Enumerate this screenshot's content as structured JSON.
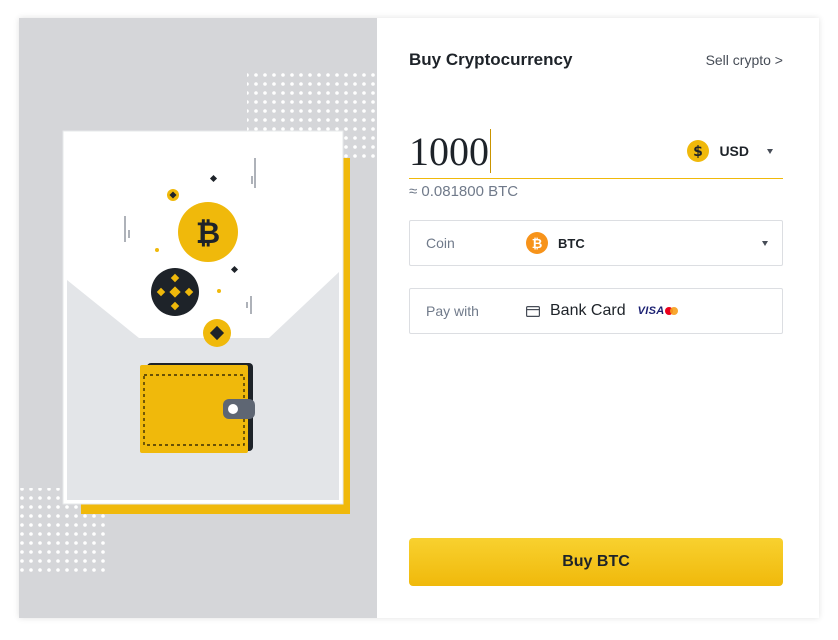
{
  "header": {
    "title": "Buy Cryptocurrency",
    "sell_link": "Sell crypto >"
  },
  "amount": {
    "value": "1000",
    "currency": "USD",
    "currency_icon": "dollar-coin-icon",
    "approx": "≈ 0.081800 BTC"
  },
  "coin_field": {
    "label": "Coin",
    "value": "BTC",
    "icon": "bitcoin-icon"
  },
  "pay_field": {
    "label": "Pay with",
    "value": "Bank Card",
    "brand": "VISA",
    "icon": "card-icon"
  },
  "buy_button": {
    "label": "Buy BTC"
  },
  "colors": {
    "accent": "#f0b90b",
    "btc_orange": "#f7931a",
    "text_primary": "#1e2329",
    "text_secondary": "#707a8a",
    "illustration_bg": "#d5d6d9"
  }
}
